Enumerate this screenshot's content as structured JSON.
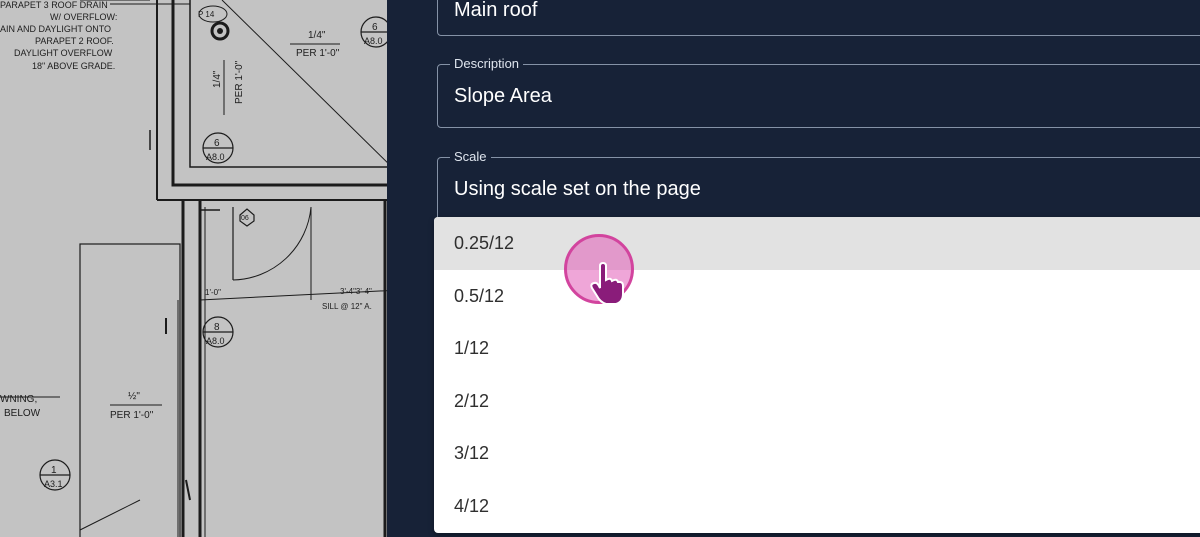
{
  "blueprint": {
    "notes": [
      "PARAPET 3 ROOF DRAIN",
      "W/ OVERFLOW:",
      "AIN AND DAYLIGHT ONTO",
      "PARAPET 2 ROOF.",
      "DAYLIGHT OVERFLOW",
      "18\" ABOVE GRADE."
    ],
    "slope_label_1": "1/4\"",
    "slope_label_1b": "PER 1'-0\"",
    "slope_label_2": "1/4\"",
    "slope_label_2b": "PER 1'-0\"",
    "callout_6_top": "6",
    "callout_6_top_sub": "A8.0",
    "callout_6_mid": "6",
    "callout_6_mid_sub": "A8.0",
    "callout_8": "8",
    "callout_8_sub": "A8.0",
    "callout_1": "1",
    "callout_1_sub": "A3.1",
    "tag_06": "06",
    "drain_tag": "P 14",
    "dim_1": "1'-0\"",
    "dim_2": "3'-4\"3'-4\"",
    "sill_note": "SILL @ 12\" A.",
    "awning_1": "WNING,",
    "awning_2": "BELOW",
    "slope_label_3": "½\"",
    "slope_label_3b": "PER 1'-0\""
  },
  "form": {
    "name_value": "Main roof",
    "description_label": "Description",
    "description_value": "Slope Area",
    "scale_label": "Scale",
    "scale_value": "Using scale set on the page"
  },
  "dropdown": {
    "options": [
      "0.25/12",
      "0.5/12",
      "1/12",
      "2/12",
      "3/12",
      "4/12"
    ],
    "hovered_index": 0
  },
  "colors": {
    "panel_bg": "#172237",
    "cursor_highlight": "#d2449e"
  }
}
